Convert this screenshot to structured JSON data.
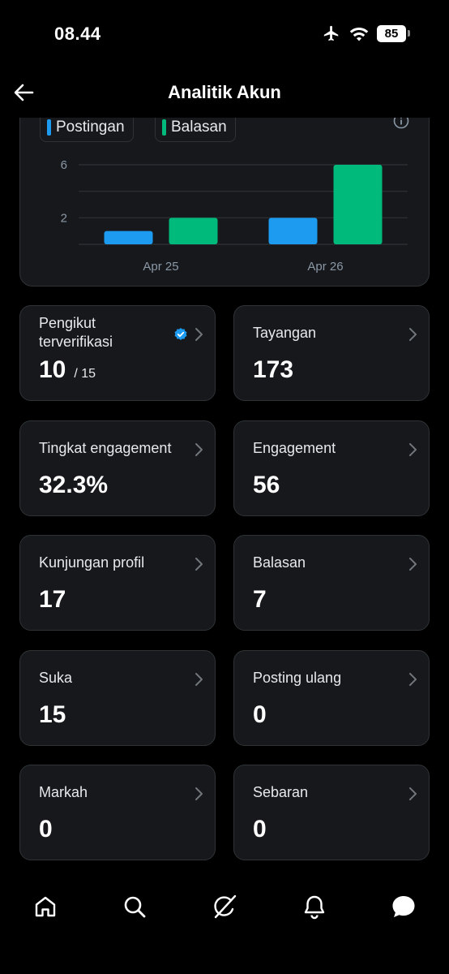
{
  "status_bar": {
    "time": "08.44",
    "battery": "85"
  },
  "header": {
    "title": "Analitik Akun"
  },
  "chart_data": {
    "type": "bar",
    "categories": [
      "Apr 25",
      "Apr 26"
    ],
    "series": [
      {
        "name": "Postingan",
        "values": [
          1,
          2
        ],
        "color": "#1d9bf0"
      },
      {
        "name": "Balasan",
        "values": [
          2,
          6
        ],
        "color": "#00ba7c"
      }
    ],
    "y_ticks": [
      "2",
      "6"
    ],
    "ylim": [
      0,
      6
    ],
    "grid": true,
    "legend": "top-left"
  },
  "metrics": [
    {
      "label": "Pengikut terverifikasi",
      "value": "10",
      "sub": "/ 15",
      "verified": true
    },
    {
      "label": "Tayangan",
      "value": "173"
    },
    {
      "label": "Tingkat engagement",
      "value": "32.3%"
    },
    {
      "label": "Engagement",
      "value": "56"
    },
    {
      "label": "Kunjungan profil",
      "value": "17"
    },
    {
      "label": "Balasan",
      "value": "7"
    },
    {
      "label": "Suka",
      "value": "15"
    },
    {
      "label": "Posting ulang",
      "value": "0"
    },
    {
      "label": "Markah",
      "value": "0"
    },
    {
      "label": "Sebaran",
      "value": "0"
    }
  ],
  "nav": [
    "home-icon",
    "search-icon",
    "grok-icon",
    "bell-icon",
    "messages-icon"
  ]
}
